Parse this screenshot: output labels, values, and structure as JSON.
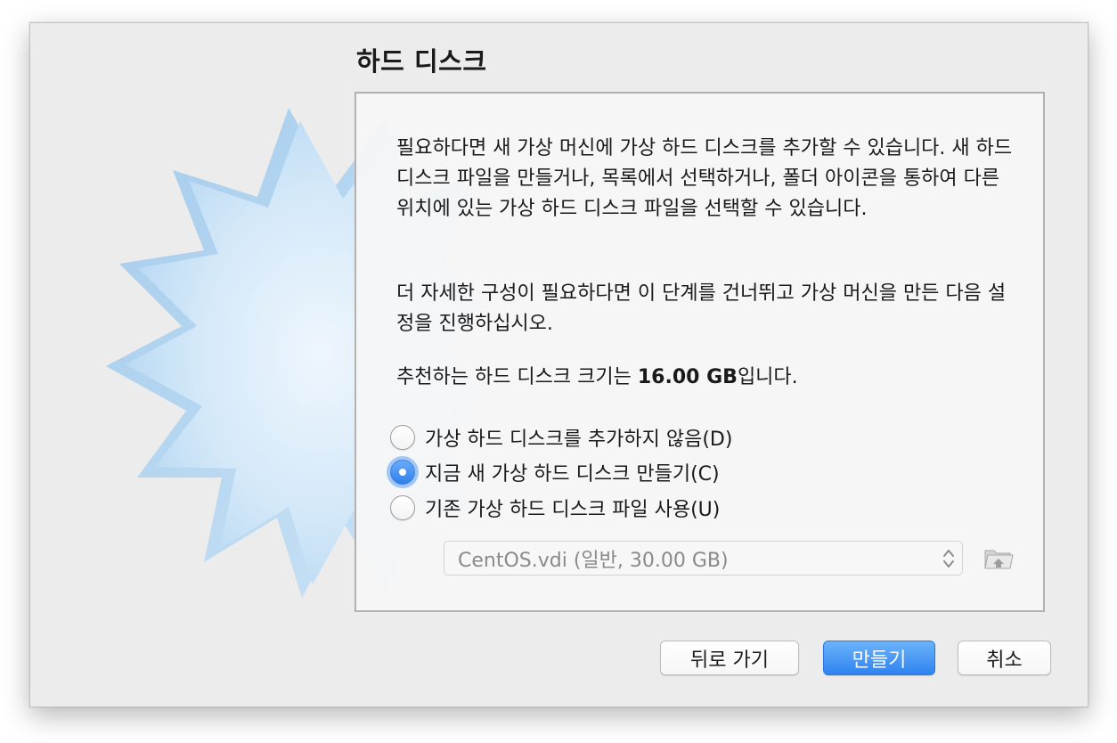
{
  "dialog": {
    "title": "하드 디스크",
    "paragraph1": "필요하다면 새 가상 머신에 가상 하드 디스크를 추가할 수 있습니다. 새 하드 디스크 파일을 만들거나, 목록에서 선택하거나, 폴더 아이콘을 통하여 다른 위치에 있는 가상 하드 디스크 파일을 선택할 수 있습니다.",
    "paragraph2": "더 자세한 구성이 필요하다면 이 단계를 건너뛰고 가상 머신을 만든 다음 설정을 진행하십시오.",
    "recommendation_prefix": "추천하는 하드 디스크 크기는 ",
    "recommendation_size": "16.00 GB",
    "recommendation_suffix": "입니다."
  },
  "options": [
    {
      "label": "가상 하드 디스크를 추가하지 않음(D)",
      "selected": false
    },
    {
      "label": "지금 새 가상 하드 디스크 만들기(C)",
      "selected": true
    },
    {
      "label": "기존 가상 하드 디스크 파일 사용(U)",
      "selected": false
    }
  ],
  "existing_disk_select": {
    "value": "CentOS.vdi (일반, 30.00 GB)",
    "enabled": false
  },
  "icons": {
    "select_arrows": "up-down-chevron-icon",
    "folder_button": "folder-open-icon",
    "background": "starburst-icon"
  },
  "buttons": {
    "back": "뒤로 가기",
    "create": "만들기",
    "cancel": "취소"
  },
  "colors": {
    "accent": "#2f83f0",
    "window_bg": "#ececec",
    "starburst": "#bcdcf5"
  }
}
